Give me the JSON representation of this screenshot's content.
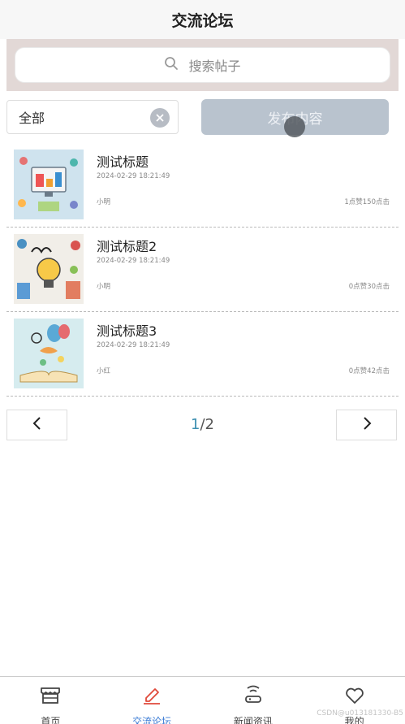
{
  "header": {
    "title": "交流论坛"
  },
  "search": {
    "placeholder": "搜索帖子"
  },
  "filter": {
    "value": "全部"
  },
  "publish": {
    "label": "发布内容"
  },
  "posts": [
    {
      "title": "测试标题",
      "date": "2024-02-29 18:21:49",
      "author": "小明",
      "stats": "1点赞150点击"
    },
    {
      "title": "测试标题2",
      "date": "2024-02-29 18:21:49",
      "author": "小明",
      "stats": "0点赞30点击"
    },
    {
      "title": "测试标题3",
      "date": "2024-02-29 18:21:49",
      "author": "小红",
      "stats": "0点赞42点击"
    }
  ],
  "pager": {
    "current": "1",
    "total": "/2"
  },
  "tabbar": [
    {
      "label": "首页",
      "icon": "shop-icon"
    },
    {
      "label": "交流论坛",
      "icon": "edit-icon"
    },
    {
      "label": "新闻资讯",
      "icon": "router-icon"
    },
    {
      "label": "我的",
      "icon": "heart-icon"
    }
  ],
  "watermark": "CSDN@u013181330-B5",
  "colors": {
    "accent": "#3a7bd5",
    "tab_active": "#e04a3b",
    "publish_bg": "#b9c3ce",
    "search_bg": "#e2d8d6"
  }
}
